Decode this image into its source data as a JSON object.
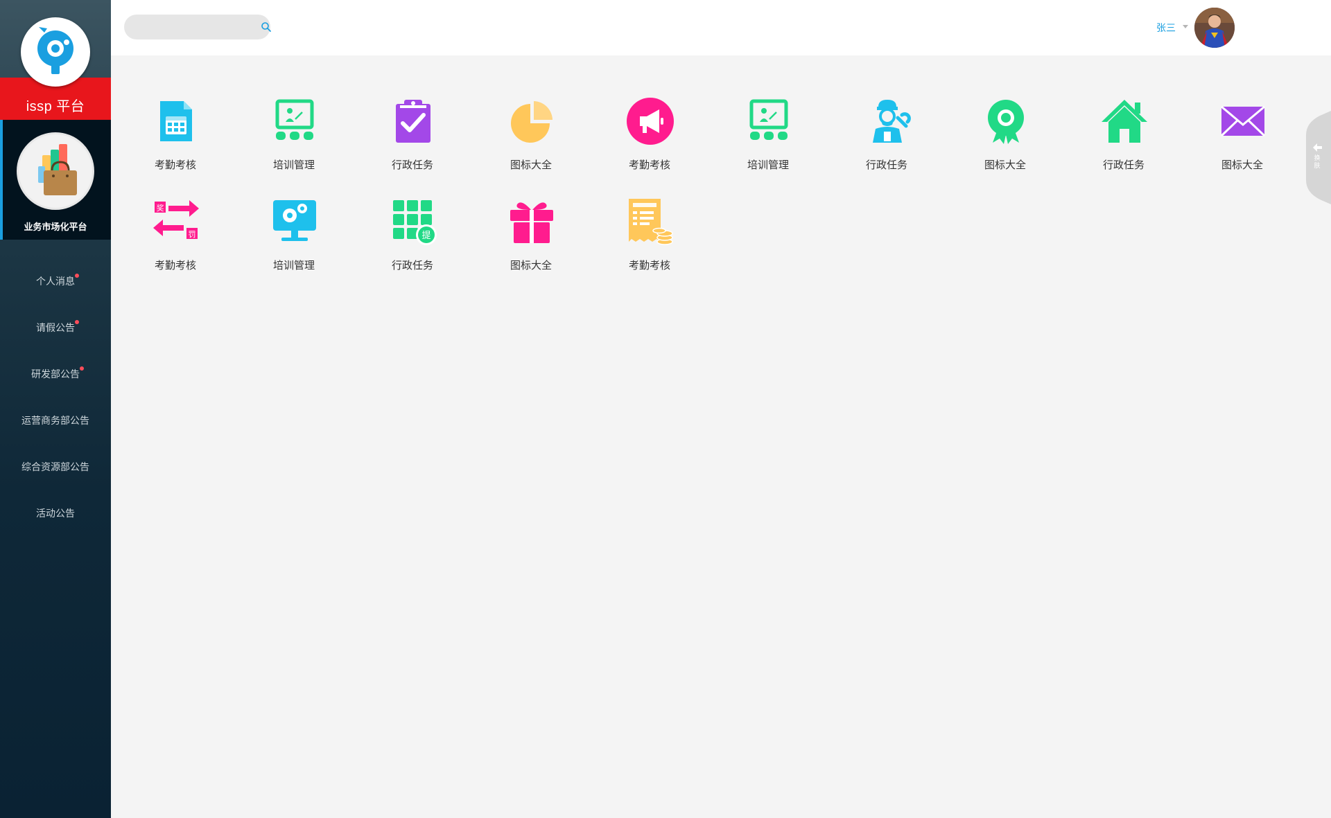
{
  "brand": {
    "logo_text": "issp 平台",
    "accent": "#e8161c",
    "highlight": "#1a9fe0"
  },
  "platform": {
    "label": "业务市场化平台"
  },
  "nav": {
    "items": [
      {
        "label": "个人消息",
        "badge": true
      },
      {
        "label": "请假公告",
        "badge": true
      },
      {
        "label": "研发部公告",
        "badge": true
      },
      {
        "label": "运营商务部公告",
        "badge": false
      },
      {
        "label": "综合资源部公告",
        "badge": false
      },
      {
        "label": "活动公告",
        "badge": false
      }
    ]
  },
  "search": {
    "placeholder": "",
    "icon": "search-icon"
  },
  "user": {
    "name": "张三"
  },
  "tiles": [
    {
      "label": "考勤考核",
      "icon": "calendar-doc-icon",
      "color": "#1ec0ec"
    },
    {
      "label": "培训管理",
      "icon": "training-board-icon",
      "color": "#21d986"
    },
    {
      "label": "行政任务",
      "icon": "clipboard-check-icon",
      "color": "#a348e8"
    },
    {
      "label": "图标大全",
      "icon": "pie-chart-icon",
      "color": "#ffc75a"
    },
    {
      "label": "考勤考核",
      "icon": "megaphone-icon",
      "color": "#ff1c8e"
    },
    {
      "label": "培训管理",
      "icon": "training-board-icon",
      "color": "#21d986"
    },
    {
      "label": "行政任务",
      "icon": "worker-wrench-icon",
      "color": "#1ec0ec"
    },
    {
      "label": "图标大全",
      "icon": "award-badge-icon",
      "color": "#21d986"
    },
    {
      "label": "行政任务",
      "icon": "home-icon",
      "color": "#21d986"
    },
    {
      "label": "图标大全",
      "icon": "envelope-icon",
      "color": "#a348e8"
    },
    {
      "label": "考勤考核",
      "icon": "reward-punish-arrows-icon",
      "color": "#ff1c8e"
    },
    {
      "label": "培训管理",
      "icon": "monitor-gears-icon",
      "color": "#1ec0ec"
    },
    {
      "label": "行政任务",
      "icon": "grid-withdraw-icon",
      "color": "#21d986"
    },
    {
      "label": "图标大全",
      "icon": "gift-icon",
      "color": "#ff1c8e"
    },
    {
      "label": "考勤考核",
      "icon": "receipt-coins-icon",
      "color": "#ffc75a"
    }
  ],
  "skin_tab": {
    "label": "换肤"
  }
}
